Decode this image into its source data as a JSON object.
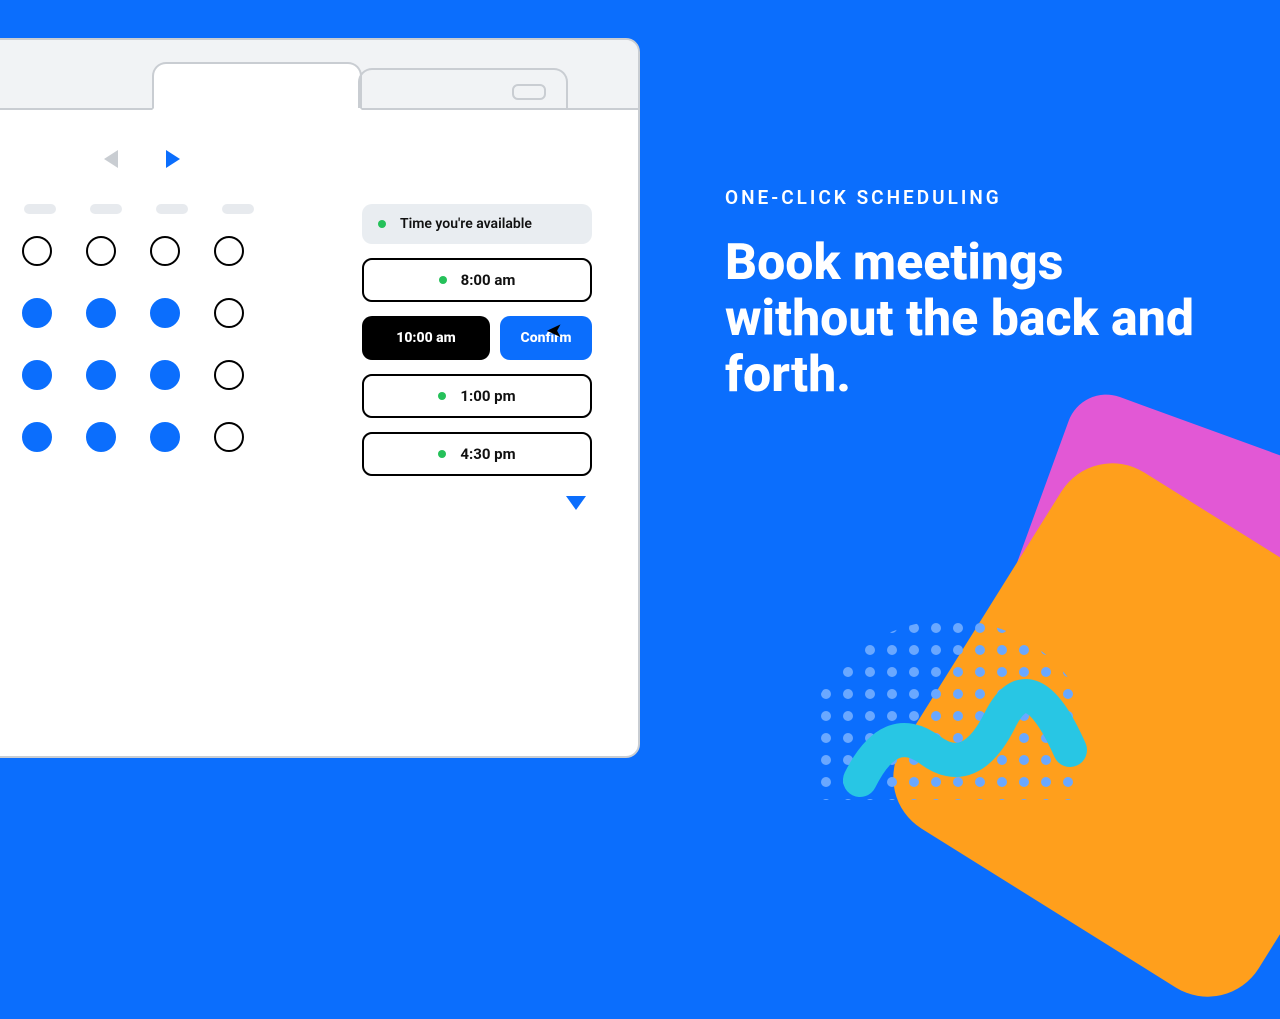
{
  "copy": {
    "eyebrow": "ONE-CLICK SCHEDULING",
    "headline": "Book meetings without the back and forth."
  },
  "calendar": {
    "nav": {
      "prev_enabled": false,
      "next_enabled": true
    },
    "rows": [
      [
        false,
        false,
        false,
        false,
        false
      ],
      [
        true,
        true,
        true,
        true,
        false
      ],
      [
        true,
        true,
        true,
        true,
        false
      ],
      [
        true,
        true,
        true,
        true,
        false
      ]
    ]
  },
  "slots": {
    "legend": "Time you're available",
    "options": [
      "8:00 am",
      "10:00 am",
      "1:00 pm",
      "4:30 pm"
    ],
    "selected": "10:00 am",
    "confirm_label": "Confirm"
  },
  "colors": {
    "brand": "#0b6efd",
    "accent_green": "#25c15a"
  }
}
